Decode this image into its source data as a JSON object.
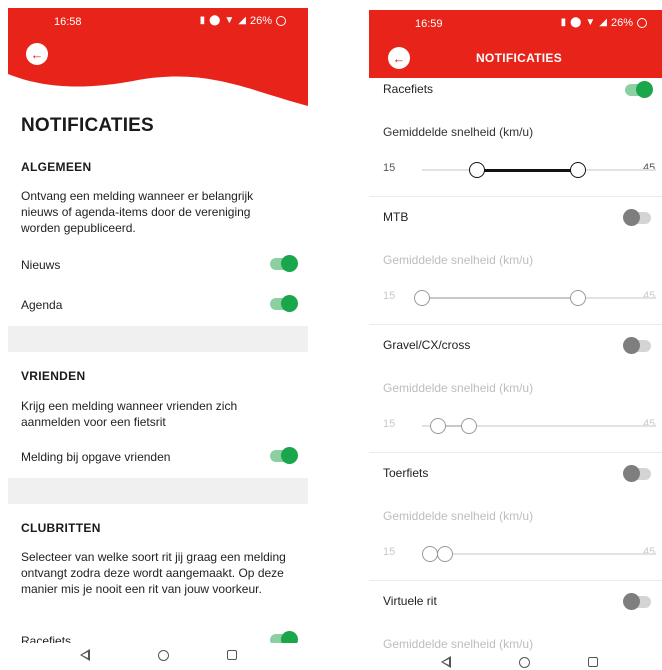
{
  "colors": {
    "brand_red": "#e8231a",
    "toggle_on": "#1aa64a",
    "toggle_off": "#7e7e7e"
  },
  "left": {
    "status": {
      "time": "16:58",
      "battery": "26%"
    },
    "title": "NOTIFICATIES",
    "algemeen": {
      "title": "ALGEMEEN",
      "description": "Ontvang een melding wanneer er belangrijk nieuws of agenda-items door de vereniging worden gepubliceerd.",
      "items": [
        {
          "label": "Nieuws",
          "on": true
        },
        {
          "label": "Agenda",
          "on": true
        }
      ]
    },
    "vrienden": {
      "title": "VRIENDEN",
      "description": "Krijg een melding wanneer vrienden zich aanmelden voor een fietsrit",
      "items": [
        {
          "label": "Melding bij opgave vrienden",
          "on": true
        }
      ]
    },
    "clubritten": {
      "title": "CLUBRITTEN",
      "description": "Selecteer van welke soort rit jij graag een melding ontvangt zodra deze wordt aangemaakt. Op deze manier mis je nooit een rit van jouw voorkeur.",
      "items": [
        {
          "label": "Racefiets",
          "on": true
        }
      ]
    }
  },
  "right": {
    "status": {
      "time": "16:59",
      "battery": "26%"
    },
    "header_title": "NOTIFICATIES",
    "speed_label": "Gemiddelde snelheid (km/u)",
    "range_min_label": "15",
    "range_max_label": "45",
    "range_min": 15,
    "range_max": 45,
    "types": [
      {
        "label": "Racefiets",
        "on": true,
        "low": 22,
        "high": 35
      },
      {
        "label": "MTB",
        "on": false,
        "low": 15,
        "high": 35
      },
      {
        "label": "Gravel/CX/cross",
        "on": false,
        "low": 17,
        "high": 21
      },
      {
        "label": "Toerfiets",
        "on": false,
        "low": 16,
        "high": 18
      },
      {
        "label": "Virtuele rit",
        "on": false
      }
    ]
  },
  "icons": {
    "back": "arrow-left-icon",
    "status": [
      "vibrate-icon",
      "location-icon",
      "wifi-icon",
      "signal-icon",
      "battery-icon"
    ],
    "nav": [
      "nav-back-icon",
      "nav-home-icon",
      "nav-recents-icon"
    ]
  }
}
